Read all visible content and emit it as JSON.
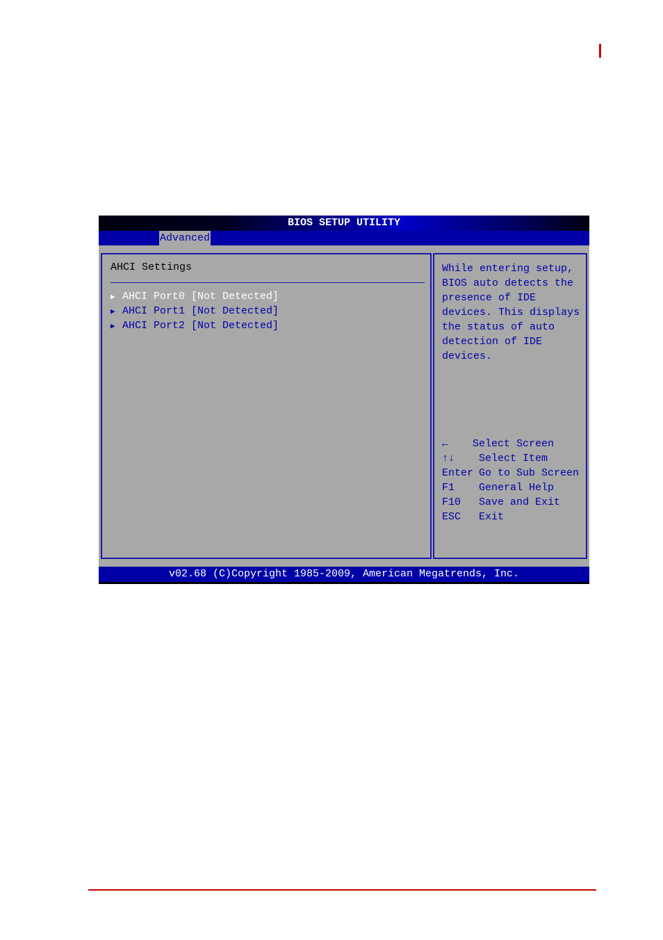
{
  "bios": {
    "title": "BIOS SETUP UTILITY",
    "tabs": [
      {
        "label": "Advanced",
        "active": true
      }
    ],
    "section_title": "AHCI Settings",
    "items": [
      {
        "label": "AHCI Port0 [Not Detected]",
        "selected": true,
        "icon": "submenu-triangle-icon"
      },
      {
        "label": "AHCI Port1 [Not Detected]",
        "selected": false,
        "icon": "submenu-triangle-icon"
      },
      {
        "label": "AHCI Port2 [Not Detected]",
        "selected": false,
        "icon": "submenu-triangle-icon"
      }
    ],
    "help_lines": [
      "While entering setup,",
      "BIOS auto detects the",
      "presence of IDE",
      "devices. This displays",
      "the status of auto",
      "detection of IDE",
      "devices."
    ],
    "keys": [
      {
        "key": "←",
        "action": "Select Screen"
      },
      {
        "key": "↑↓",
        "action": "Select Item"
      },
      {
        "key": "Enter",
        "action": "Go to Sub Screen"
      },
      {
        "key": "F1",
        "action": "General Help"
      },
      {
        "key": "F10",
        "action": "Save and Exit"
      },
      {
        "key": "ESC",
        "action": "Exit"
      }
    ],
    "footer": "v02.68 (C)Copyright 1985-2009, American Megatrends, Inc.",
    "colors": {
      "background": "#a8a8a8",
      "bar_blue": "#0000a8",
      "text_blue": "#0000a8",
      "selected_text": "#ffffff",
      "page_accent_red": "#cc0000"
    }
  }
}
